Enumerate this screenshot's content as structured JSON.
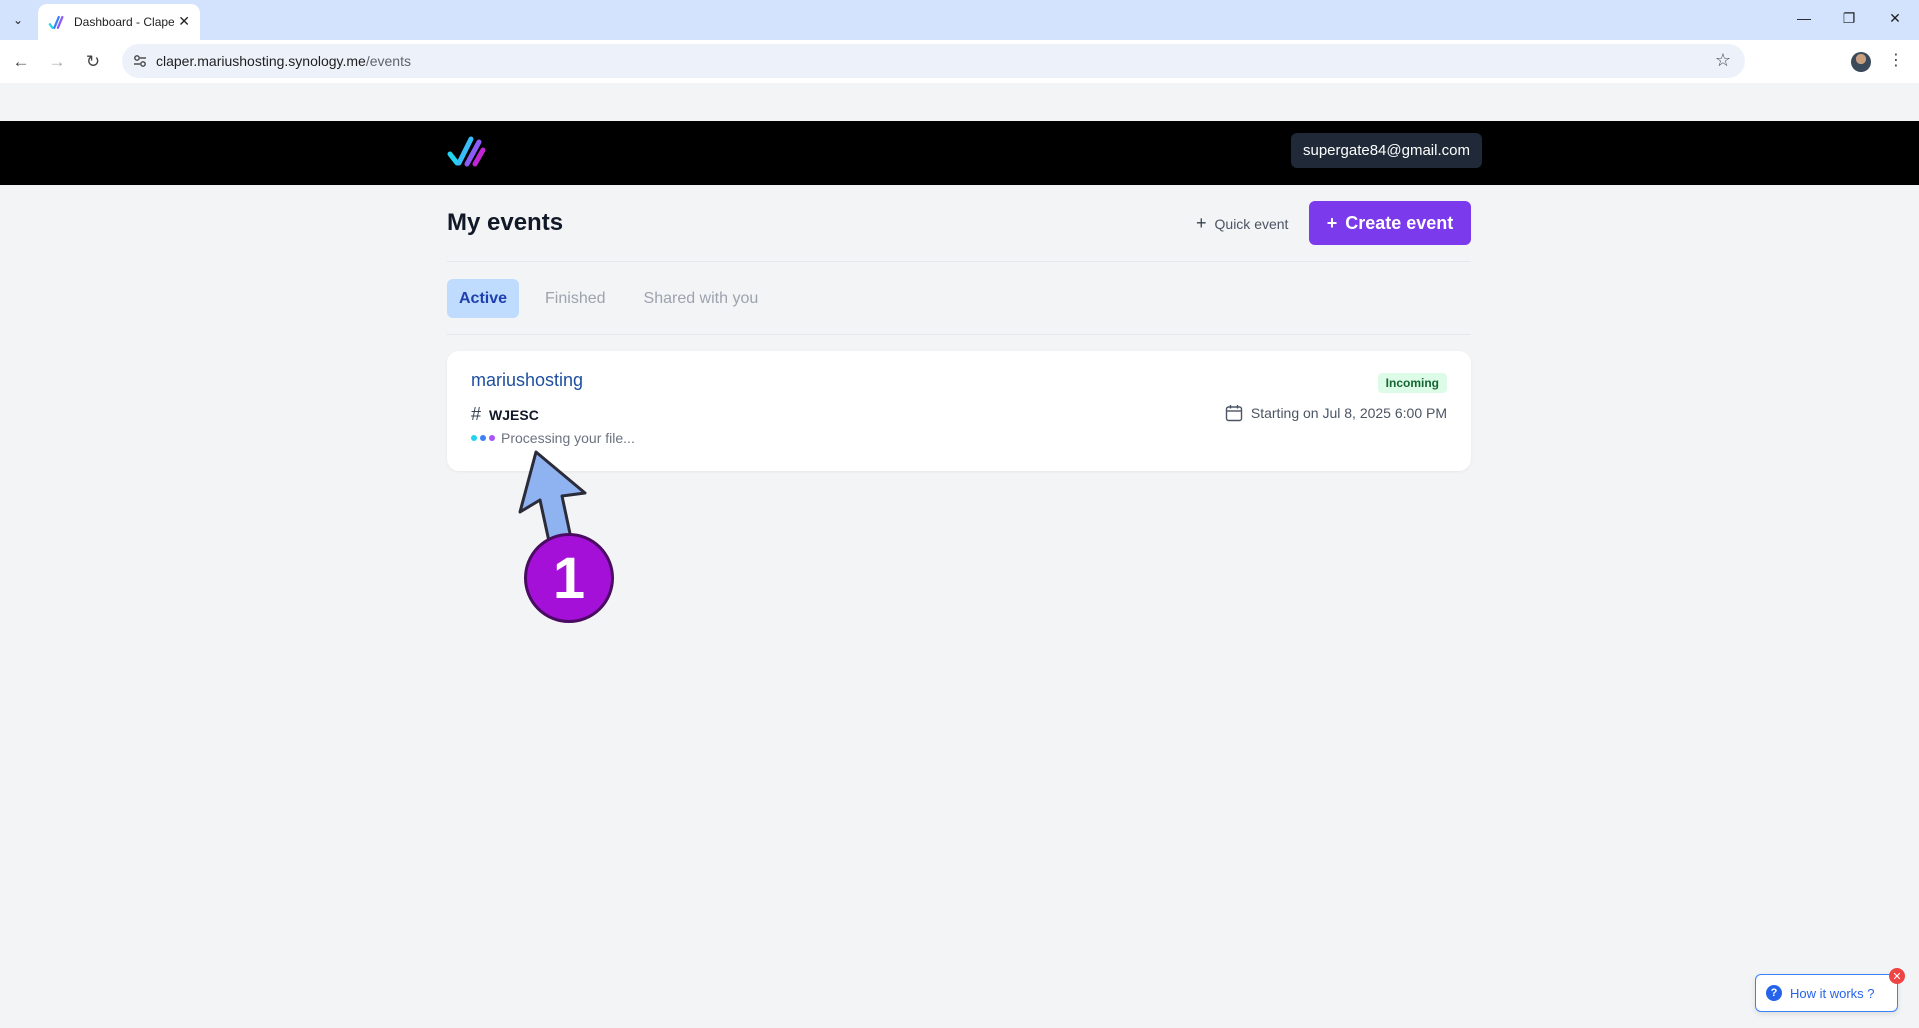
{
  "browser": {
    "tab_title": "Dashboard - Claper",
    "url_host": "claper.mariushosting.synology.me",
    "url_path": "/events"
  },
  "header": {
    "user_email": "supergate84@gmail.com"
  },
  "main": {
    "title": "My events",
    "quick_event_label": "Quick event",
    "create_event_label": "Create event",
    "tabs": [
      {
        "label": "Active",
        "active": true
      },
      {
        "label": "Finished",
        "active": false
      },
      {
        "label": "Shared with you",
        "active": false
      }
    ],
    "event": {
      "name": "mariushosting",
      "status": "Incoming",
      "code": "WJESC",
      "start": "Starting on Jul 8, 2025 6:00 PM",
      "processing": "Processing your file..."
    }
  },
  "annotation": {
    "number": "1"
  },
  "help": {
    "label": "How it works ?"
  },
  "colors": {
    "accent": "#7c3aed",
    "annotation": "#a510d8",
    "link": "#1e4fa1"
  }
}
